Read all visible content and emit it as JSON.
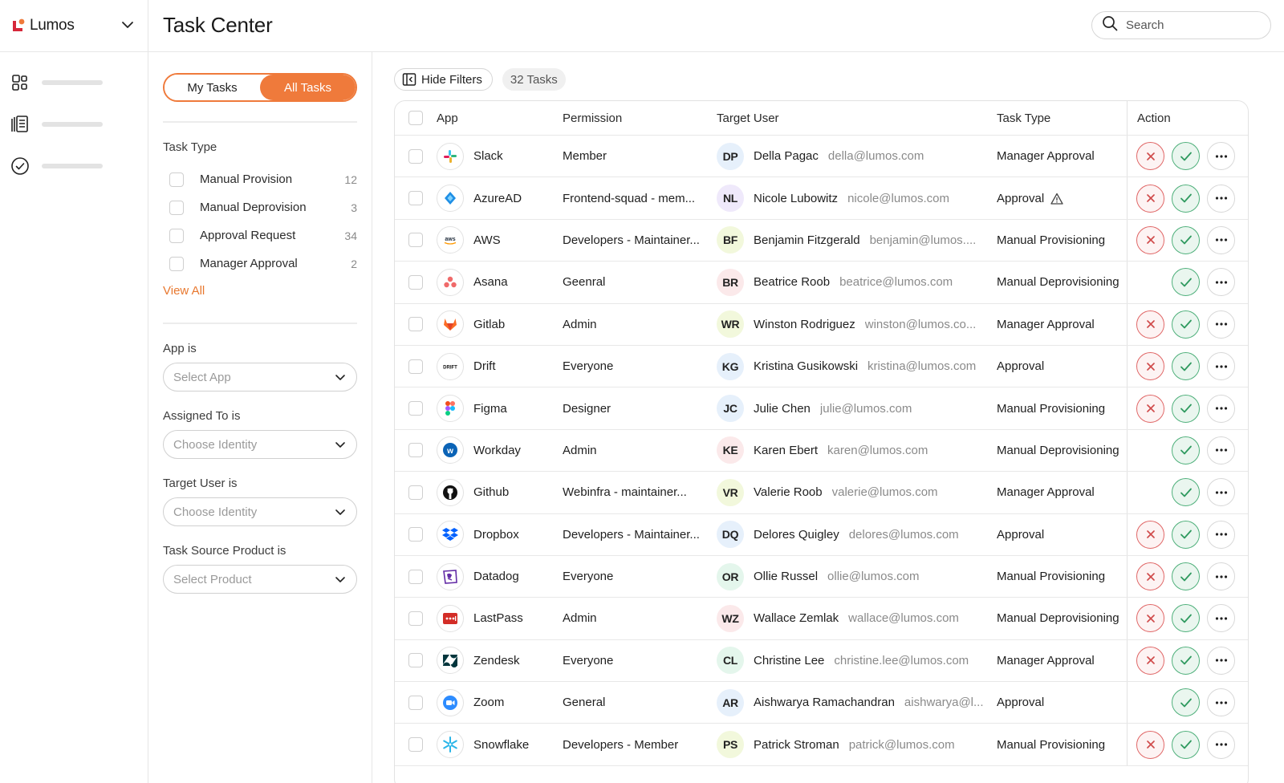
{
  "brand": {
    "name": "Lumos"
  },
  "header": {
    "title": "Task Center",
    "search_placeholder": "Search"
  },
  "filters": {
    "toggle": {
      "my_tasks": "My Tasks",
      "all_tasks": "All Tasks"
    },
    "task_type_title": "Task Type",
    "task_types": [
      {
        "label": "Manual Provision",
        "count": "12"
      },
      {
        "label": "Manual Deprovision",
        "count": "3"
      },
      {
        "label": "Approval Request",
        "count": "34"
      },
      {
        "label": "Manager Approval",
        "count": "2"
      }
    ],
    "view_all": "View All",
    "app_label": "App is",
    "app_placeholder": "Select App",
    "assigned_label": "Assigned To is",
    "assigned_placeholder": "Choose Identity",
    "target_label": "Target User is",
    "target_placeholder": "Choose Identity",
    "source_label": "Task Source Product is",
    "source_placeholder": "Select Product"
  },
  "toolbar": {
    "hide_filters": "Hide Filters",
    "task_count": "32 Tasks"
  },
  "table": {
    "columns": {
      "app": "App",
      "permission": "Permission",
      "target_user": "Target User",
      "task_type": "Task Type",
      "action": "Action"
    },
    "rows": [
      {
        "app": "Slack",
        "icon": "slack-icon",
        "permission": "Member",
        "initials": "DP",
        "avatar_color": "#e6f0fb",
        "name": "Della Pagac",
        "email": "della@lumos.com",
        "task_type": "Manager Approval",
        "warn": false,
        "reject": true
      },
      {
        "app": "AzureAD",
        "icon": "azuread-icon",
        "permission": "Frontend-squad - mem...",
        "initials": "NL",
        "avatar_color": "#efe9fb",
        "name": "Nicole Lubowitz",
        "email": "nicole@lumos.com",
        "task_type": "Approval",
        "warn": true,
        "reject": true
      },
      {
        "app": "AWS",
        "icon": "aws-icon",
        "permission": "Developers - Maintainer...",
        "initials": "BF",
        "avatar_color": "#f2f8dc",
        "name": "Benjamin Fitzgerald",
        "email": "benjamin@lumos....",
        "task_type": "Manual Provisioning",
        "warn": false,
        "reject": true
      },
      {
        "app": "Asana",
        "icon": "asana-icon",
        "permission": "Geenral",
        "initials": "BR",
        "avatar_color": "#fbe9ea",
        "name": "Beatrice Roob",
        "email": "beatrice@lumos.com",
        "task_type": "Manual Deprovisioning",
        "warn": false,
        "reject": false
      },
      {
        "app": "Gitlab",
        "icon": "gitlab-icon",
        "permission": "Admin",
        "initials": "WR",
        "avatar_color": "#f2f8dc",
        "name": "Winston Rodriguez",
        "email": "winston@lumos.co...",
        "task_type": "Manager Approval",
        "warn": false,
        "reject": true
      },
      {
        "app": "Drift",
        "icon": "drift-icon",
        "permission": "Everyone",
        "initials": "KG",
        "avatar_color": "#e6f0fb",
        "name": "Kristina Gusikowski",
        "email": "kristina@lumos.com",
        "task_type": "Approval",
        "warn": false,
        "reject": true
      },
      {
        "app": "Figma",
        "icon": "figma-icon",
        "permission": "Designer",
        "initials": "JC",
        "avatar_color": "#e6f0fb",
        "name": "Julie Chen",
        "email": "julie@lumos.com",
        "task_type": "Manual Provisioning",
        "warn": false,
        "reject": true
      },
      {
        "app": "Workday",
        "icon": "workday-icon",
        "permission": "Admin",
        "initials": "KE",
        "avatar_color": "#fbe9ea",
        "name": "Karen Ebert",
        "email": "karen@lumos.com",
        "task_type": "Manual Deprovisioning",
        "warn": false,
        "reject": false
      },
      {
        "app": "Github",
        "icon": "github-icon",
        "permission": "Webinfra - maintainer...",
        "initials": "VR",
        "avatar_color": "#f2f8dc",
        "name": "Valerie Roob",
        "email": "valerie@lumos.com",
        "task_type": "Manager Approval",
        "warn": false,
        "reject": false
      },
      {
        "app": "Dropbox",
        "icon": "dropbox-icon",
        "permission": "Developers - Maintainer...",
        "initials": "DQ",
        "avatar_color": "#e6f0fb",
        "name": "Delores Quigley",
        "email": "delores@lumos.com",
        "task_type": "Approval",
        "warn": false,
        "reject": true
      },
      {
        "app": "Datadog",
        "icon": "datadog-icon",
        "permission": "Everyone",
        "initials": "OR",
        "avatar_color": "#e4f6ec",
        "name": "Ollie Russel",
        "email": "ollie@lumos.com",
        "task_type": "Manual Provisioning",
        "warn": false,
        "reject": true
      },
      {
        "app": "LastPass",
        "icon": "lastpass-icon",
        "permission": "Admin",
        "initials": "WZ",
        "avatar_color": "#fbe9ea",
        "name": "Wallace Zemlak",
        "email": "wallace@lumos.com",
        "task_type": "Manual Deprovisioning",
        "warn": false,
        "reject": true
      },
      {
        "app": "Zendesk",
        "icon": "zendesk-icon",
        "permission": "Everyone",
        "initials": "CL",
        "avatar_color": "#e4f6ec",
        "name": "Christine Lee",
        "email": "christine.lee@lumos.com",
        "task_type": "Manager Approval",
        "warn": false,
        "reject": true
      },
      {
        "app": "Zoom",
        "icon": "zoom-icon",
        "permission": "General",
        "initials": "AR",
        "avatar_color": "#e6f0fb",
        "name": "Aishwarya Ramachandran",
        "email": "aishwarya@l...",
        "task_type": "Approval",
        "warn": false,
        "reject": false
      },
      {
        "app": "Snowflake",
        "icon": "snowflake-icon",
        "permission": "Developers - Member",
        "initials": "PS",
        "avatar_color": "#f2f8dc",
        "name": "Patrick Stroman",
        "email": "patrick@lumos.com",
        "task_type": "Manual Provisioning",
        "warn": false,
        "reject": true
      }
    ]
  },
  "colors": {
    "accent": "#ef7a3b",
    "approve": "#4fb07b",
    "reject": "#e06767"
  }
}
